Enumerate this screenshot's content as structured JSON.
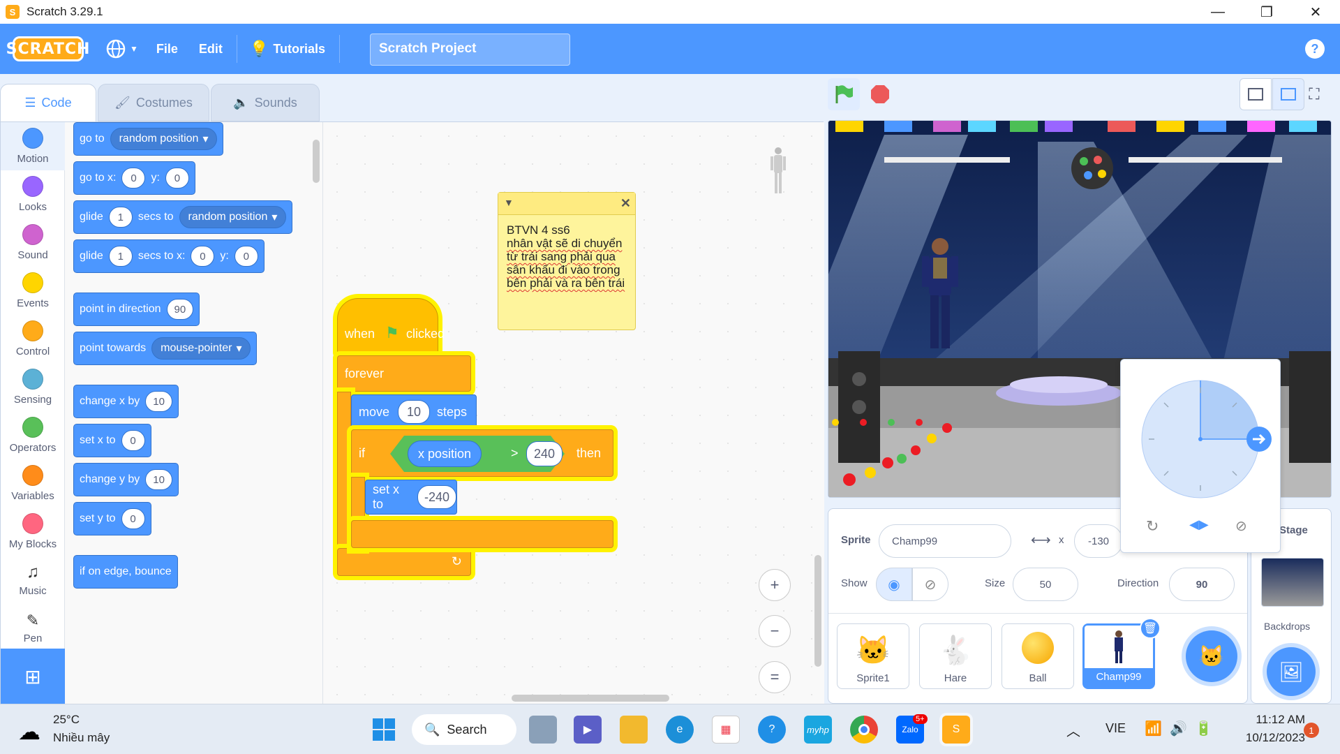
{
  "window": {
    "title": "Scratch 3.29.1",
    "min": "—",
    "max": "❐",
    "close": "✕"
  },
  "menu": {
    "logo": "SCRATCH",
    "file": "File",
    "edit": "Edit",
    "tutorials": "Tutorials",
    "project_title": "Scratch Project",
    "help": "?"
  },
  "tabs": {
    "code": "Code",
    "costumes": "Costumes",
    "sounds": "Sounds"
  },
  "categories": [
    {
      "label": "Motion",
      "color": "#4c97ff"
    },
    {
      "label": "Looks",
      "color": "#9966ff"
    },
    {
      "label": "Sound",
      "color": "#cf63cf"
    },
    {
      "label": "Events",
      "color": "#ffd500"
    },
    {
      "label": "Control",
      "color": "#ffab19"
    },
    {
      "label": "Sensing",
      "color": "#5cb1d6"
    },
    {
      "label": "Operators",
      "color": "#59c059"
    },
    {
      "label": "Variables",
      "color": "#ff8c1a"
    },
    {
      "label": "My Blocks",
      "color": "#ff6680"
    },
    {
      "label": "Music",
      "color": ""
    },
    {
      "label": "Pen",
      "color": ""
    }
  ],
  "palette": {
    "goto": "go to",
    "goto_dd": "random position",
    "gotoxy": "go to x:",
    "gotoxy_x": "0",
    "gotoxy_y_lbl": "y:",
    "gotoxy_y": "0",
    "glide": "glide",
    "glide_secs": "1",
    "glide_to": "secs to",
    "glide_dd": "random position",
    "glide2": "glide",
    "glide2_secs": "1",
    "glide2_to": "secs to x:",
    "glide2_x": "0",
    "glide2_y_lbl": "y:",
    "glide2_y": "0",
    "point_dir": "point in direction",
    "point_dir_val": "90",
    "point_towards": "point towards",
    "point_towards_dd": "mouse-pointer",
    "change_x": "change x by",
    "change_x_val": "10",
    "set_x": "set x to",
    "set_x_val": "0",
    "change_y": "change y by",
    "change_y_val": "10",
    "set_y": "set y to",
    "set_y_val": "0",
    "bounce": "if on edge, bounce"
  },
  "script": {
    "when": "when",
    "clicked": "clicked",
    "forever": "forever",
    "move": "move",
    "move_val": "10",
    "steps": "steps",
    "if": "if",
    "xpos": "x position",
    "gt": ">",
    "cmp_val": "240",
    "then": "then",
    "setx": "set x to",
    "setx_val": "-240"
  },
  "note": {
    "line1": "BTVN 4 ss6",
    "body": "nhân vật sẽ di chuyển từ trái sang phải qua sân khấu  đi vào trong bên phải và ra bên trái",
    "close": "✕"
  },
  "zoom": {
    "in": "+",
    "out": "−",
    "reset": "="
  },
  "sprite": {
    "label": "Sprite",
    "name": "Champ99",
    "x_label": "x",
    "x_val": "-130",
    "show_label": "Show",
    "size_label": "Size",
    "size_val": "50",
    "dir_label": "Direction",
    "dir_val": "90"
  },
  "sprites": [
    {
      "name": "Sprite1"
    },
    {
      "name": "Hare"
    },
    {
      "name": "Ball"
    },
    {
      "name": "Champ99"
    }
  ],
  "stage_panel": {
    "title": "Stage",
    "backdrops": "Backdrops"
  },
  "taskbar": {
    "temp": "25°C",
    "weather": "Nhiều mây",
    "search": "Search",
    "lang": "VIE",
    "time": "11:12 AM",
    "date": "10/12/2023",
    "notif": "1",
    "zalo_badge": "5+"
  }
}
